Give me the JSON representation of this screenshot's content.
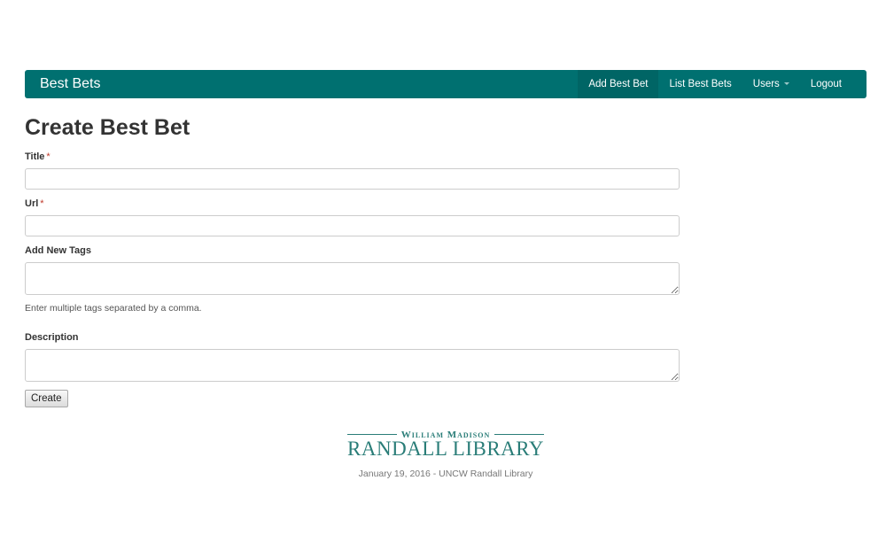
{
  "navbar": {
    "brand": "Best Bets",
    "items": [
      {
        "label": "Add Best Bet"
      },
      {
        "label": "List Best Bets"
      },
      {
        "label": "Users"
      },
      {
        "label": "Logout"
      }
    ],
    "color": "#007070"
  },
  "page": {
    "title": "Create Best Bet"
  },
  "form": {
    "title_label": "Title",
    "url_label": "Url",
    "required_mark": "*",
    "tags_label": "Add New Tags",
    "tags_help": "Enter multiple tags separated by a comma.",
    "description_label": "Description",
    "create_button": "Create",
    "title_value": "",
    "url_value": "",
    "tags_value": "",
    "description_value": ""
  },
  "logo": {
    "line1": "William Madison",
    "line2": "RANDALL LIBRARY"
  },
  "footer": {
    "text": "January 19, 2016 - UNCW Randall Library"
  }
}
